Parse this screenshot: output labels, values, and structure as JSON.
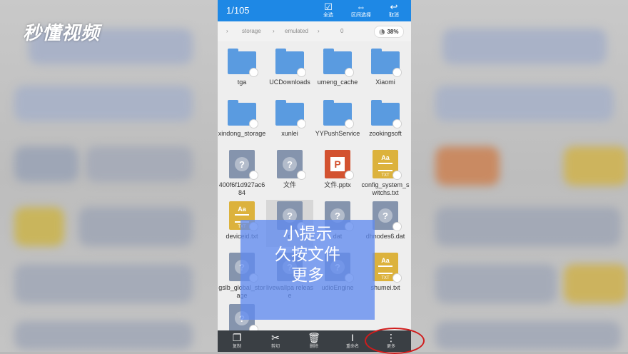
{
  "watermark": "秒懂视频",
  "topbar": {
    "count": "1/105",
    "actions": [
      {
        "icon": "☑",
        "label": "全选"
      },
      {
        "icon": "⇔",
        "label": "区间选择"
      },
      {
        "icon": "↩",
        "label": "取消"
      }
    ]
  },
  "path": {
    "crumbs": [
      "storage",
      "emulated",
      "0"
    ],
    "usage": "38%"
  },
  "files": [
    {
      "name": "tga",
      "type": "folder"
    },
    {
      "name": "UCDownloads",
      "type": "folder"
    },
    {
      "name": "umeng_cache",
      "type": "folder"
    },
    {
      "name": "Xiaomi",
      "type": "folder"
    },
    {
      "name": "xindong_storage",
      "type": "folder"
    },
    {
      "name": "xunlei",
      "type": "folder"
    },
    {
      "name": "YYPushService",
      "type": "folder"
    },
    {
      "name": "zookingsoft",
      "type": "folder"
    },
    {
      "name": "400f6f1d927ac684",
      "type": "unknown"
    },
    {
      "name": "文件",
      "type": "unknown"
    },
    {
      "name": "文件.pptx",
      "type": "pptx"
    },
    {
      "name": "config_system_switchs.txt",
      "type": "txt"
    },
    {
      "name": "deviceid.txt",
      "type": "txt"
    },
    {
      "name": "d",
      "type": "unknown"
    },
    {
      "name": "dat",
      "type": "unknown"
    },
    {
      "name": "dhnodes6.dat",
      "type": "unknown"
    },
    {
      "name": "gslb_global_storage",
      "type": "unknown"
    },
    {
      "name": "livewallpa release",
      "type": "unknown"
    },
    {
      "name": "udioEngine",
      "type": "unknown"
    },
    {
      "name": "shumei.txt",
      "type": "txt"
    },
    {
      "name": "",
      "type": "unknown"
    }
  ],
  "overlay": {
    "line1": "小提示",
    "line2": "久按文件",
    "line3": "更多"
  },
  "bottombar": [
    {
      "icon": "❐",
      "label": "复制"
    },
    {
      "icon": "✂",
      "label": "剪切"
    },
    {
      "icon": "🗑",
      "label": "删除"
    },
    {
      "icon": "I",
      "label": "重命名"
    },
    {
      "icon": "⋮",
      "label": "更多"
    }
  ]
}
